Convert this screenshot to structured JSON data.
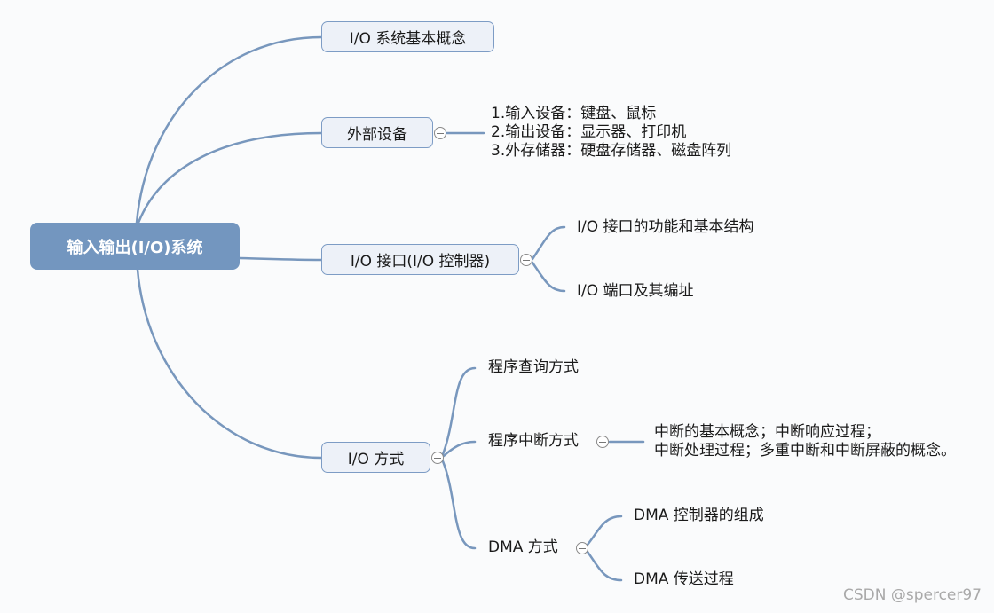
{
  "root": {
    "label": "输入输出(I/O)系统"
  },
  "branches": {
    "basic": {
      "label": "I/O 系统基本概念"
    },
    "devices": {
      "label": "外部设备",
      "details": [
        "1.输入设备：键盘、鼠标",
        "2.输出设备：显示器、打印机",
        "3.外存储器：硬盘存储器、磁盘阵列"
      ]
    },
    "interface": {
      "label": "I/O 接口(I/O 控制器)",
      "children": [
        "I/O 接口的功能和基本结构",
        "I/O 端口及其编址"
      ]
    },
    "methods": {
      "label": "I/O 方式",
      "polling": {
        "label": "程序查询方式"
      },
      "interrupt": {
        "label": "程序中断方式",
        "details": [
          "中断的基本概念；中断响应过程；",
          "中断处理过程；多重中断和中断屏蔽的概念。"
        ]
      },
      "dma": {
        "label": "DMA 方式",
        "children": [
          "DMA 控制器的组成",
          "DMA 传送过程"
        ]
      }
    }
  },
  "watermark": "CSDN @spercer97",
  "colors": {
    "root_fill": "#7396bf",
    "node_fill": "#edf1f8",
    "link": "#7897bd"
  }
}
